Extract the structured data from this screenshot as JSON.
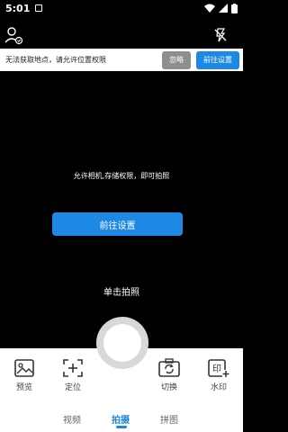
{
  "status_bar": {
    "time": "5:01"
  },
  "banner": {
    "message": "无法获取地点，请允许位置权限",
    "ignore_label": "忽略",
    "settings_label": "前往设置"
  },
  "viewfinder": {
    "permission_message": "允许相机,存储权限，即可拍照",
    "settings_label": "前往设置",
    "tap_hint": "单击拍照"
  },
  "tools": {
    "preview": "预览",
    "locate": "定位",
    "switch": "切换",
    "watermark": "水印"
  },
  "tabs": [
    {
      "label": "视频",
      "active": false
    },
    {
      "label": "拍摄",
      "active": true
    },
    {
      "label": "拼图",
      "active": false
    }
  ],
  "colors": {
    "accent": "#1e88e5"
  }
}
